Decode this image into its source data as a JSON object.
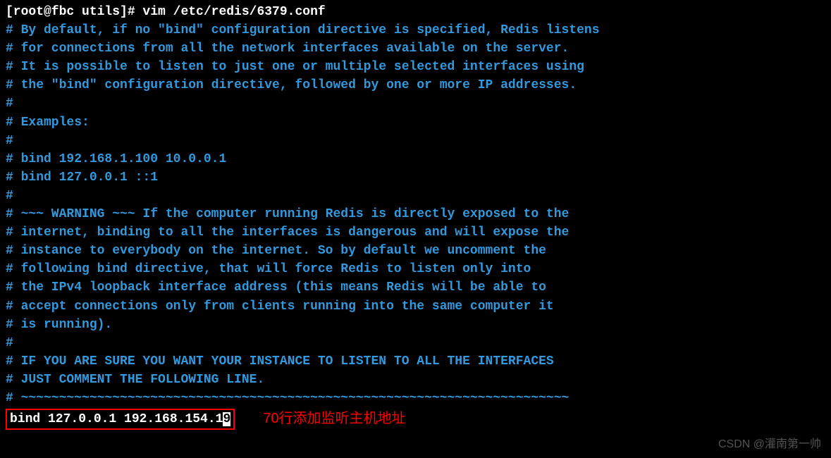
{
  "terminal": {
    "prompt": "[root@fbc utils]# vim /etc/redis/6379.conf",
    "lines": {
      "l0": "",
      "l1": "# By default, if no \"bind\" configuration directive is specified, Redis listens",
      "l2": "# for connections from all the network interfaces available on the server.",
      "l3": "# It is possible to listen to just one or multiple selected interfaces using",
      "l4": "# the \"bind\" configuration directive, followed by one or more IP addresses.",
      "l5": "#",
      "l6": "# Examples:",
      "l7": "#",
      "l8": "# bind 192.168.1.100 10.0.0.1",
      "l9": "# bind 127.0.0.1 ::1",
      "l10": "#",
      "l11": "# ~~~ WARNING ~~~ If the computer running Redis is directly exposed to the",
      "l12": "# internet, binding to all the interfaces is dangerous and will expose the",
      "l13": "# instance to everybody on the internet. So by default we uncomment the",
      "l14": "# following bind directive, that will force Redis to listen only into",
      "l15": "# the IPv4 loopback interface address (this means Redis will be able to",
      "l16": "# accept connections only from clients running into the same computer it",
      "l17": "# is running).",
      "l18": "#",
      "l19": "# IF YOU ARE SURE YOU WANT YOUR INSTANCE TO LISTEN TO ALL THE INTERFACES",
      "l20": "# JUST COMMENT THE FOLLOWING LINE.",
      "l21": "# ~~~~~~~~~~~~~~~~~~~~~~~~~~~~~~~~~~~~~~~~~~~~~~~~~~~~~~~~~~~~~~~~~~~~~~~~"
    },
    "bind_line_prefix": "bind 127.0.0.1 192.168.154.1",
    "bind_line_cursor": "9"
  },
  "annotation": {
    "text": "70行添加监听主机地址"
  },
  "watermark": {
    "text": "CSDN @灌南第一帅"
  }
}
